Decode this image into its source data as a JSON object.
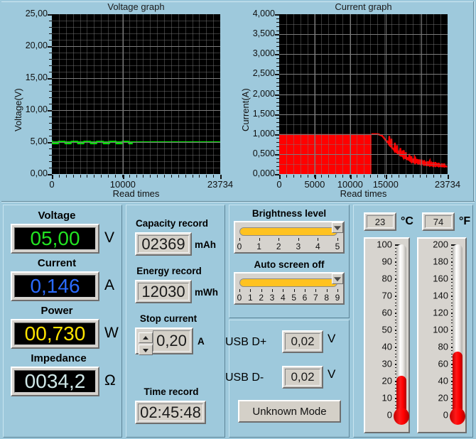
{
  "chart_data": [
    {
      "type": "line",
      "title": "Voltage graph",
      "xlabel": "Read times",
      "ylabel": "Voltage(V)",
      "yticks": [
        "0,00",
        "5,00",
        "10,00",
        "15,00",
        "20,00",
        "25,00"
      ],
      "ylim": [
        0,
        25
      ],
      "xticks": [
        "0",
        "10000",
        "23734"
      ],
      "xlim": [
        0,
        23734
      ],
      "grid": true,
      "series": [
        {
          "name": "Voltage",
          "color": "#00e000",
          "note": "flat line at 5,00 V across entire record; slightly noisy for first ~11500 samples",
          "points": [
            [
              0,
              5.0
            ],
            [
              2000,
              5.0
            ],
            [
              4000,
              5.0
            ],
            [
              6000,
              5.0
            ],
            [
              8000,
              5.0
            ],
            [
              10000,
              5.0
            ],
            [
              11500,
              5.0
            ],
            [
              13000,
              5.0
            ],
            [
              16000,
              5.0
            ],
            [
              20000,
              5.0
            ],
            [
              23734,
              5.0
            ]
          ]
        }
      ]
    },
    {
      "type": "area",
      "title": "Current graph",
      "xlabel": "Read times",
      "ylabel": "Current(A)",
      "yticks": [
        "0,000",
        "0,500",
        "1,000",
        "1,500",
        "2,000",
        "2,500",
        "3,000",
        "3,500",
        "4,000"
      ],
      "ylim": [
        0,
        4
      ],
      "xticks": [
        "0",
        "5000",
        "10000",
        "15000",
        "23734"
      ],
      "xlim": [
        0,
        23734
      ],
      "grid": true,
      "series": [
        {
          "name": "Current",
          "color": "#ff0000",
          "note": "constant 1,000 A (filled) until ~13000 reads, then exponential decay to ~0,15 A with noise spikes",
          "points": [
            [
              0,
              1.0
            ],
            [
              5000,
              1.0
            ],
            [
              10000,
              1.0
            ],
            [
              13000,
              1.0
            ],
            [
              13900,
              1.0
            ],
            [
              14500,
              0.96
            ],
            [
              15000,
              0.85
            ],
            [
              15600,
              0.7
            ],
            [
              16200,
              0.58
            ],
            [
              17000,
              0.46
            ],
            [
              17800,
              0.38
            ],
            [
              18600,
              0.31
            ],
            [
              19400,
              0.27
            ],
            [
              20200,
              0.24
            ],
            [
              21000,
              0.22
            ],
            [
              21800,
              0.2
            ],
            [
              22600,
              0.19
            ],
            [
              23734,
              0.18
            ]
          ]
        }
      ]
    }
  ],
  "graphs": {
    "voltage": {
      "title": "Voltage graph",
      "ylabel": "Voltage(V)",
      "xlabel": "Read times",
      "yticks": [
        "25,00",
        "20,00",
        "15,00",
        "10,00",
        "5,00",
        "0,00"
      ],
      "xticks": [
        "0",
        "10000",
        "23734"
      ],
      "trace_color": "#00e000"
    },
    "current": {
      "title": "Current graph",
      "ylabel": "Current(A)",
      "xlabel": "Read times",
      "yticks": [
        "4,000",
        "3,500",
        "3,000",
        "2,500",
        "2,000",
        "1,500",
        "1,000",
        "0,500",
        "0,000"
      ],
      "xticks": [
        "0",
        "5000",
        "10000",
        "15000",
        "23734"
      ],
      "trace_color": "#ff0000"
    }
  },
  "measurements": {
    "voltage": {
      "label": "Voltage",
      "value": "05,00",
      "unit": "V",
      "color": "#22e322"
    },
    "current": {
      "label": "Current",
      "value": "0,146",
      "unit": "A",
      "color": "#2a6bff"
    },
    "power": {
      "label": "Power",
      "value": "00,730",
      "unit": "W",
      "color": "#ffe400"
    },
    "impedance": {
      "label": "Impedance",
      "value": "0034,2",
      "unit": "Ω",
      "color": "#cfe8e8"
    }
  },
  "records": {
    "capacity": {
      "label": "Capacity record",
      "value": "02369",
      "unit": "mAh"
    },
    "energy": {
      "label": "Energy record",
      "value": "12030",
      "unit": "mWh"
    },
    "stop_current": {
      "label": "Stop current",
      "value": "0,20",
      "unit": "A"
    },
    "time": {
      "label": "Time record",
      "value": "02:45:48"
    }
  },
  "screen": {
    "brightness": {
      "label": "Brightness level",
      "value": 5,
      "min": 0,
      "max": 5,
      "ticks": [
        "0",
        "1",
        "2",
        "3",
        "4",
        "5"
      ],
      "fill_color": "#ffc220"
    },
    "auto_off": {
      "label": "Auto screen off",
      "value": 9,
      "min": 0,
      "max": 9,
      "ticks": [
        "0",
        "1",
        "2",
        "3",
        "4",
        "5",
        "6",
        "7",
        "8",
        "9"
      ],
      "fill_color": "#ffc220"
    }
  },
  "usb": {
    "dplus": {
      "label": "USB D+",
      "value": "0,02",
      "unit": "V"
    },
    "dminus": {
      "label": "USB D-",
      "value": "0,02",
      "unit": "V"
    },
    "mode_button": "Unknown Mode"
  },
  "temperature": {
    "celsius": {
      "value": "23",
      "unit": "°C",
      "scale_max": 100,
      "ticks": [
        "100",
        "90",
        "80",
        "70",
        "60",
        "50",
        "40",
        "30",
        "20",
        "10",
        "0"
      ]
    },
    "fahrenheit": {
      "value": "74",
      "unit": "°F",
      "scale_max": 200,
      "ticks": [
        "200",
        "180",
        "160",
        "140",
        "120",
        "100",
        "80",
        "60",
        "40",
        "20",
        "0"
      ]
    }
  }
}
